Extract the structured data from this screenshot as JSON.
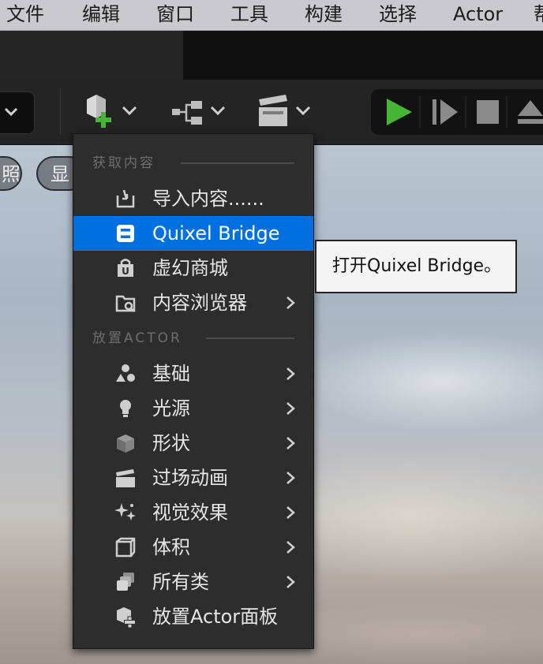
{
  "menubar": {
    "items": [
      "文件",
      "编辑",
      "窗口",
      "工具",
      "构建",
      "选择",
      "Actor",
      "帮"
    ]
  },
  "viewport": {
    "pills": [
      "照",
      "显"
    ]
  },
  "dropdown": {
    "section_get_content": "获取内容",
    "section_place_actor": "放置ACTOR",
    "items": [
      {
        "label": "导入内容......",
        "icon": "import-icon"
      },
      {
        "label": "Quixel Bridge",
        "icon": "quixel-bridge-icon",
        "selected": true
      },
      {
        "label": "虚幻商城",
        "icon": "marketplace-bag-icon"
      },
      {
        "label": "内容浏览器",
        "icon": "content-browser-icon",
        "submenu": true
      },
      {
        "label": "基础",
        "icon": "basic-shapes-icon",
        "submenu": true
      },
      {
        "label": "光源",
        "icon": "lightbulb-icon",
        "submenu": true
      },
      {
        "label": "形状",
        "icon": "cube-icon",
        "submenu": true
      },
      {
        "label": "过场动画",
        "icon": "clapperboard-icon",
        "submenu": true
      },
      {
        "label": "视觉效果",
        "icon": "sparkles-icon",
        "submenu": true
      },
      {
        "label": "体积",
        "icon": "volume-icon",
        "submenu": true
      },
      {
        "label": "所有类",
        "icon": "all-classes-icon",
        "submenu": true
      },
      {
        "label": "放置Actor面板",
        "icon": "place-actor-panel-icon"
      }
    ]
  },
  "tooltip": {
    "text": "打开Quixel Bridge。"
  },
  "colors": {
    "selection": "#0070e0",
    "play_green": "#47b536",
    "menu_bg": "#2d2d2d"
  }
}
